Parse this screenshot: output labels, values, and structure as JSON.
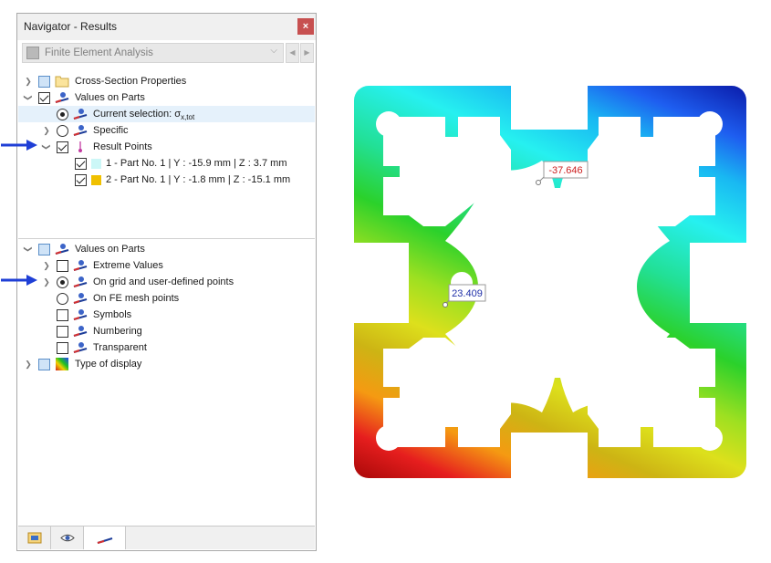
{
  "panel": {
    "title": "Navigator - Results",
    "close_glyph": "×",
    "module": "Finite Element Analysis"
  },
  "tree": {
    "cross_section": "Cross-Section Properties",
    "values_on_parts": "Values on Parts",
    "current_selection": "Current selection: σ",
    "current_selection_sub": "x,tot",
    "specific": "Specific",
    "result_points": "Result Points",
    "point1": "1 - Part No. 1 | Y : -15.9 mm | Z : 3.7 mm",
    "point2": "2 - Part No. 1 | Y : -1.8 mm | Z : -15.1 mm"
  },
  "tree2": {
    "values_on_parts": "Values on Parts",
    "extreme_values": "Extreme Values",
    "on_grid": "On grid and user-defined points",
    "on_fe_mesh": "On FE mesh points",
    "symbols": "Symbols",
    "numbering": "Numbering",
    "transparent": "Transparent",
    "type_of_display": "Type of display"
  },
  "colors": {
    "point1_swatch": "#ccf7f7",
    "point2_swatch": "#f0c000",
    "accent_arrow": "#1f3fd6"
  },
  "section": {
    "label_top": "-37.646",
    "label_left": "23.409"
  },
  "icons": [
    "folder-icon",
    "results-icon",
    "result-point-icon",
    "type-of-display-icon"
  ]
}
